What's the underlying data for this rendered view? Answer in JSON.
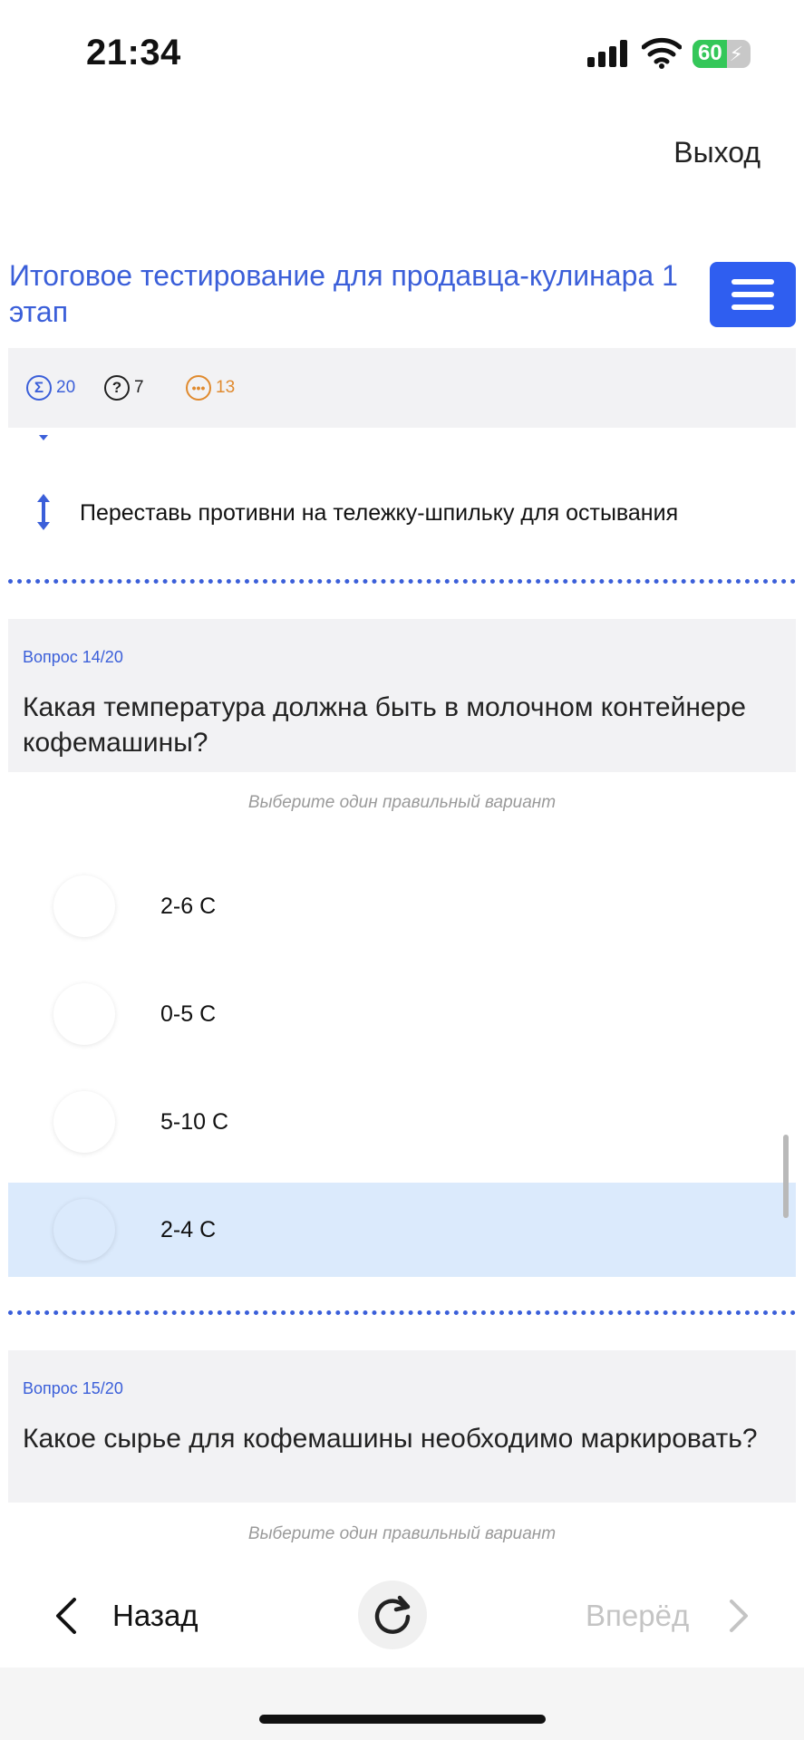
{
  "status_bar": {
    "time": "21:34",
    "battery_percent": "60",
    "battery_level": 0.6,
    "battery_color": "#34c759",
    "icons": [
      "signal-icon",
      "wifi-icon",
      "battery-charging-icon"
    ]
  },
  "header": {
    "exit_label": "Выход",
    "title": "Итоговое тестирование для продавца-кулинара 1 этап",
    "menu_icon": "hamburger-menu-icon",
    "accent_color": "#2f5ef0"
  },
  "stats": {
    "total": "20",
    "answered": "7",
    "remaining": "13",
    "total_icon": "sum-icon",
    "answered_icon": "question-icon",
    "remaining_icon": "ellipsis-icon",
    "colors": {
      "total": "#3b5fd9",
      "answered": "#222222",
      "remaining": "#e08a2e"
    }
  },
  "previous_question": {
    "last_item_text": "Переставь противни на тележку-шпильку для остывания"
  },
  "question_14": {
    "number_label": "Вопрос 14/20",
    "text": "Какая температура должна быть в молочном контейнере кофемашины?",
    "hint": "Выберите один правильный вариант",
    "options": [
      {
        "label": "2-6 С",
        "selected": false
      },
      {
        "label": "0-5 С",
        "selected": false
      },
      {
        "label": "5-10 С",
        "selected": false
      },
      {
        "label": "2-4 С",
        "selected": true
      }
    ]
  },
  "question_15": {
    "number_label": "Вопрос 15/20",
    "text": "Какое сырье для кофемашины необходимо маркировать?",
    "hint": "Выберите один правильный вариант"
  },
  "nav": {
    "back_label": "Назад",
    "forward_label": "Вперёд",
    "reload_icon": "reload-icon"
  }
}
